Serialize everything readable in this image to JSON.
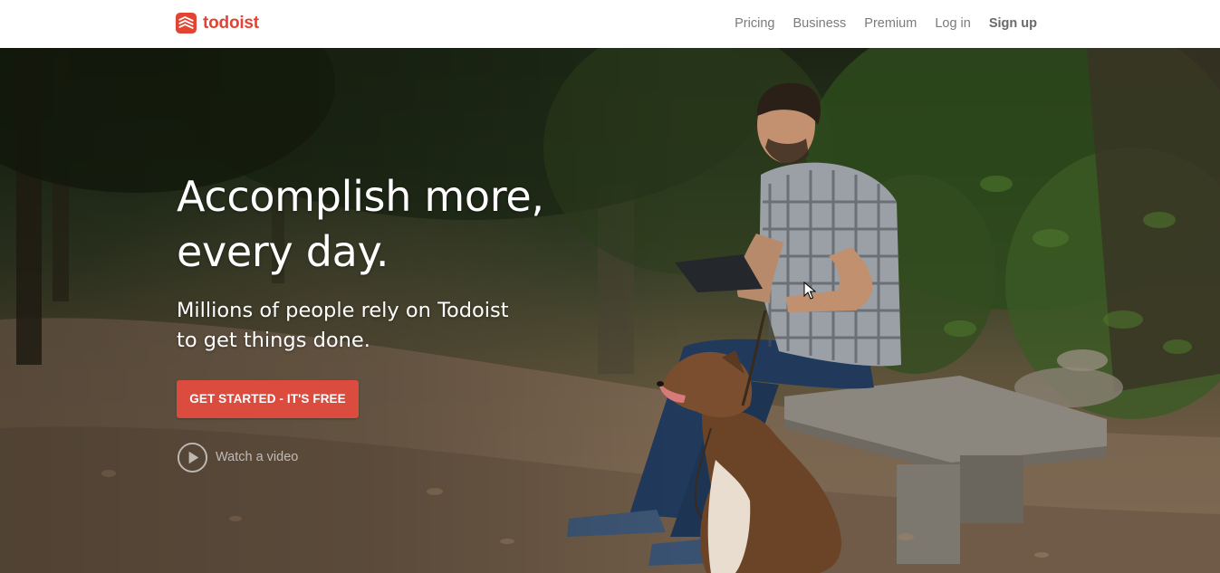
{
  "header": {
    "logo_text": "todoist",
    "logo_icon": "todoist-logo-icon",
    "brand_color": "#e44332",
    "nav": [
      {
        "label": "Pricing"
      },
      {
        "label": "Business"
      },
      {
        "label": "Premium"
      },
      {
        "label": "Log in"
      },
      {
        "label": "Sign up"
      }
    ]
  },
  "hero": {
    "headline_line1": "Accomplish more,",
    "headline_line2": "every day.",
    "subhead_line1": "Millions of people rely on Todoist",
    "subhead_line2": "to get things done.",
    "cta_label": "GET STARTED - IT'S FREE",
    "cta_color": "#db4c3f",
    "video_label": "Watch a video",
    "video_icon": "play-circle-icon",
    "background_image": "man-on-bench-with-tablet-and-dog-photo"
  },
  "pointer": {
    "icon": "mouse-cursor-icon"
  }
}
